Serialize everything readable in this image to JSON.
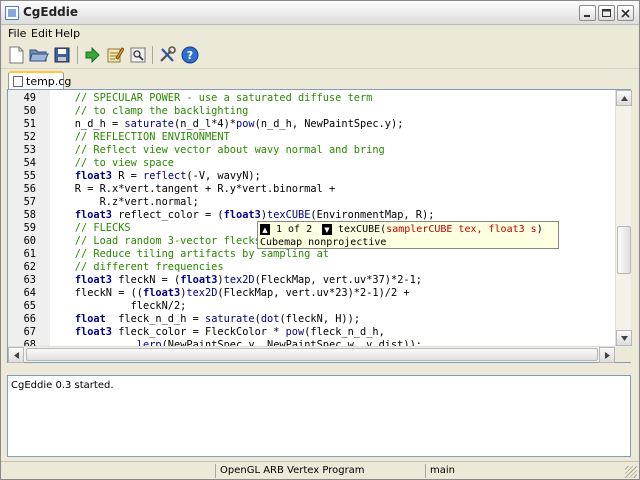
{
  "window": {
    "title": "CgEddie"
  },
  "menu": {
    "file": "File",
    "edit": "Edit",
    "help": "Help"
  },
  "toolbar": {
    "icons": [
      "new-file-icon",
      "open-folder-icon",
      "save-disk-icon",
      "run-arrow-icon",
      "edit-notepad-icon",
      "find-icon",
      "tools-icon",
      "help-icon"
    ]
  },
  "tab": {
    "label": "temp.cg"
  },
  "editor": {
    "lines": [
      {
        "no": "49",
        "segs": [
          {
            "t": "    // SPECULAR POWER - use a saturated diffuse term",
            "c": "cmt"
          }
        ]
      },
      {
        "no": "50",
        "segs": [
          {
            "t": "    // to clamp the backlighting",
            "c": "cmt"
          }
        ]
      },
      {
        "no": "51",
        "segs": [
          {
            "t": "    n_d_h = ",
            "c": "plain"
          },
          {
            "t": "saturate",
            "c": "ty"
          },
          {
            "t": "(n_d_l*4)*",
            "c": "plain"
          },
          {
            "t": "pow",
            "c": "ty"
          },
          {
            "t": "(n_d_h, NewPaintSpec.y);",
            "c": "plain"
          }
        ]
      },
      {
        "no": "52",
        "segs": [
          {
            "t": "    // REFLECTION ENVIRONMENT",
            "c": "cmt"
          }
        ]
      },
      {
        "no": "53",
        "segs": [
          {
            "t": "    // Reflect view vector about wavy normal and bring",
            "c": "cmt"
          }
        ]
      },
      {
        "no": "54",
        "segs": [
          {
            "t": "    // to view space",
            "c": "cmt"
          }
        ]
      },
      {
        "no": "55",
        "segs": [
          {
            "t": "    ",
            "c": "plain"
          },
          {
            "t": "float3",
            "c": "kw"
          },
          {
            "t": " R = ",
            "c": "plain"
          },
          {
            "t": "reflect",
            "c": "ty"
          },
          {
            "t": "(-V, wavyN);",
            "c": "plain"
          }
        ]
      },
      {
        "no": "56",
        "segs": [
          {
            "t": "    R = R.x*vert.tangent + R.y*vert.binormal +",
            "c": "plain"
          }
        ]
      },
      {
        "no": "57",
        "segs": [
          {
            "t": "        R.z*vert.normal;",
            "c": "plain"
          }
        ]
      },
      {
        "no": "58",
        "segs": [
          {
            "t": "    ",
            "c": "plain"
          },
          {
            "t": "float3",
            "c": "kw"
          },
          {
            "t": " reflect_color = (",
            "c": "plain"
          },
          {
            "t": "float3",
            "c": "kw"
          },
          {
            "t": ")",
            "c": "plain"
          },
          {
            "t": "texCUBE",
            "c": "ty"
          },
          {
            "t": "(EnvironmentMap, R);",
            "c": "plain"
          }
        ]
      },
      {
        "no": "59",
        "segs": [
          {
            "t": "    // FLECKS",
            "c": "cmt"
          }
        ]
      },
      {
        "no": "60",
        "segs": [
          {
            "t": "    // Load random 3-vector flecks",
            "c": "cmt"
          }
        ]
      },
      {
        "no": "61",
        "segs": [
          {
            "t": "    // Reduce tiling artifacts by sampling at",
            "c": "cmt"
          }
        ]
      },
      {
        "no": "62",
        "segs": [
          {
            "t": "    // different frequencies",
            "c": "cmt"
          }
        ]
      },
      {
        "no": "63",
        "segs": [
          {
            "t": "    ",
            "c": "plain"
          },
          {
            "t": "float3",
            "c": "kw"
          },
          {
            "t": " fleckN = (",
            "c": "plain"
          },
          {
            "t": "float3",
            "c": "kw"
          },
          {
            "t": ")",
            "c": "plain"
          },
          {
            "t": "tex2D",
            "c": "ty"
          },
          {
            "t": "(FleckMap, vert.uv*37)*2-1;",
            "c": "plain"
          }
        ]
      },
      {
        "no": "64",
        "segs": [
          {
            "t": "    fleckN = ((",
            "c": "plain"
          },
          {
            "t": "float3",
            "c": "kw"
          },
          {
            "t": ")",
            "c": "plain"
          },
          {
            "t": "tex2D",
            "c": "ty"
          },
          {
            "t": "(FleckMap, vert.uv*23)*2-1)/2 +",
            "c": "plain"
          }
        ]
      },
      {
        "no": "65",
        "segs": [
          {
            "t": "             fleckN/2;",
            "c": "plain"
          }
        ]
      },
      {
        "no": "66",
        "segs": [
          {
            "t": "    ",
            "c": "plain"
          },
          {
            "t": "float",
            "c": "kw"
          },
          {
            "t": "  fleck_n_d_h = ",
            "c": "plain"
          },
          {
            "t": "saturate",
            "c": "ty"
          },
          {
            "t": "(",
            "c": "plain"
          },
          {
            "t": "dot",
            "c": "ty"
          },
          {
            "t": "(fleckN, H));",
            "c": "plain"
          }
        ]
      },
      {
        "no": "67",
        "segs": [
          {
            "t": "    ",
            "c": "plain"
          },
          {
            "t": "float3",
            "c": "kw"
          },
          {
            "t": " fleck_color = FleckColor * ",
            "c": "plain"
          },
          {
            "t": "pow",
            "c": "ty"
          },
          {
            "t": "(fleck_n_d_h,",
            "c": "plain"
          }
        ]
      },
      {
        "no": "68",
        "segs": [
          {
            "t": "              ",
            "c": "plain"
          },
          {
            "t": "lerp",
            "c": "ty"
          },
          {
            "t": "(NewPaintSpec.y, NewPaintSpec.w, v_dist));",
            "c": "plain"
          }
        ]
      }
    ]
  },
  "calltip": {
    "counter": "1 of 2",
    "func": "texCUBE(",
    "params": "samplerCUBE tex, float3 s",
    "close": ")",
    "desc": "Cubemap nonprojective"
  },
  "output": {
    "text": "CgEddie 0.3 started."
  },
  "status": {
    "profile": "OpenGL ARB Vertex Program",
    "entry": "main"
  }
}
